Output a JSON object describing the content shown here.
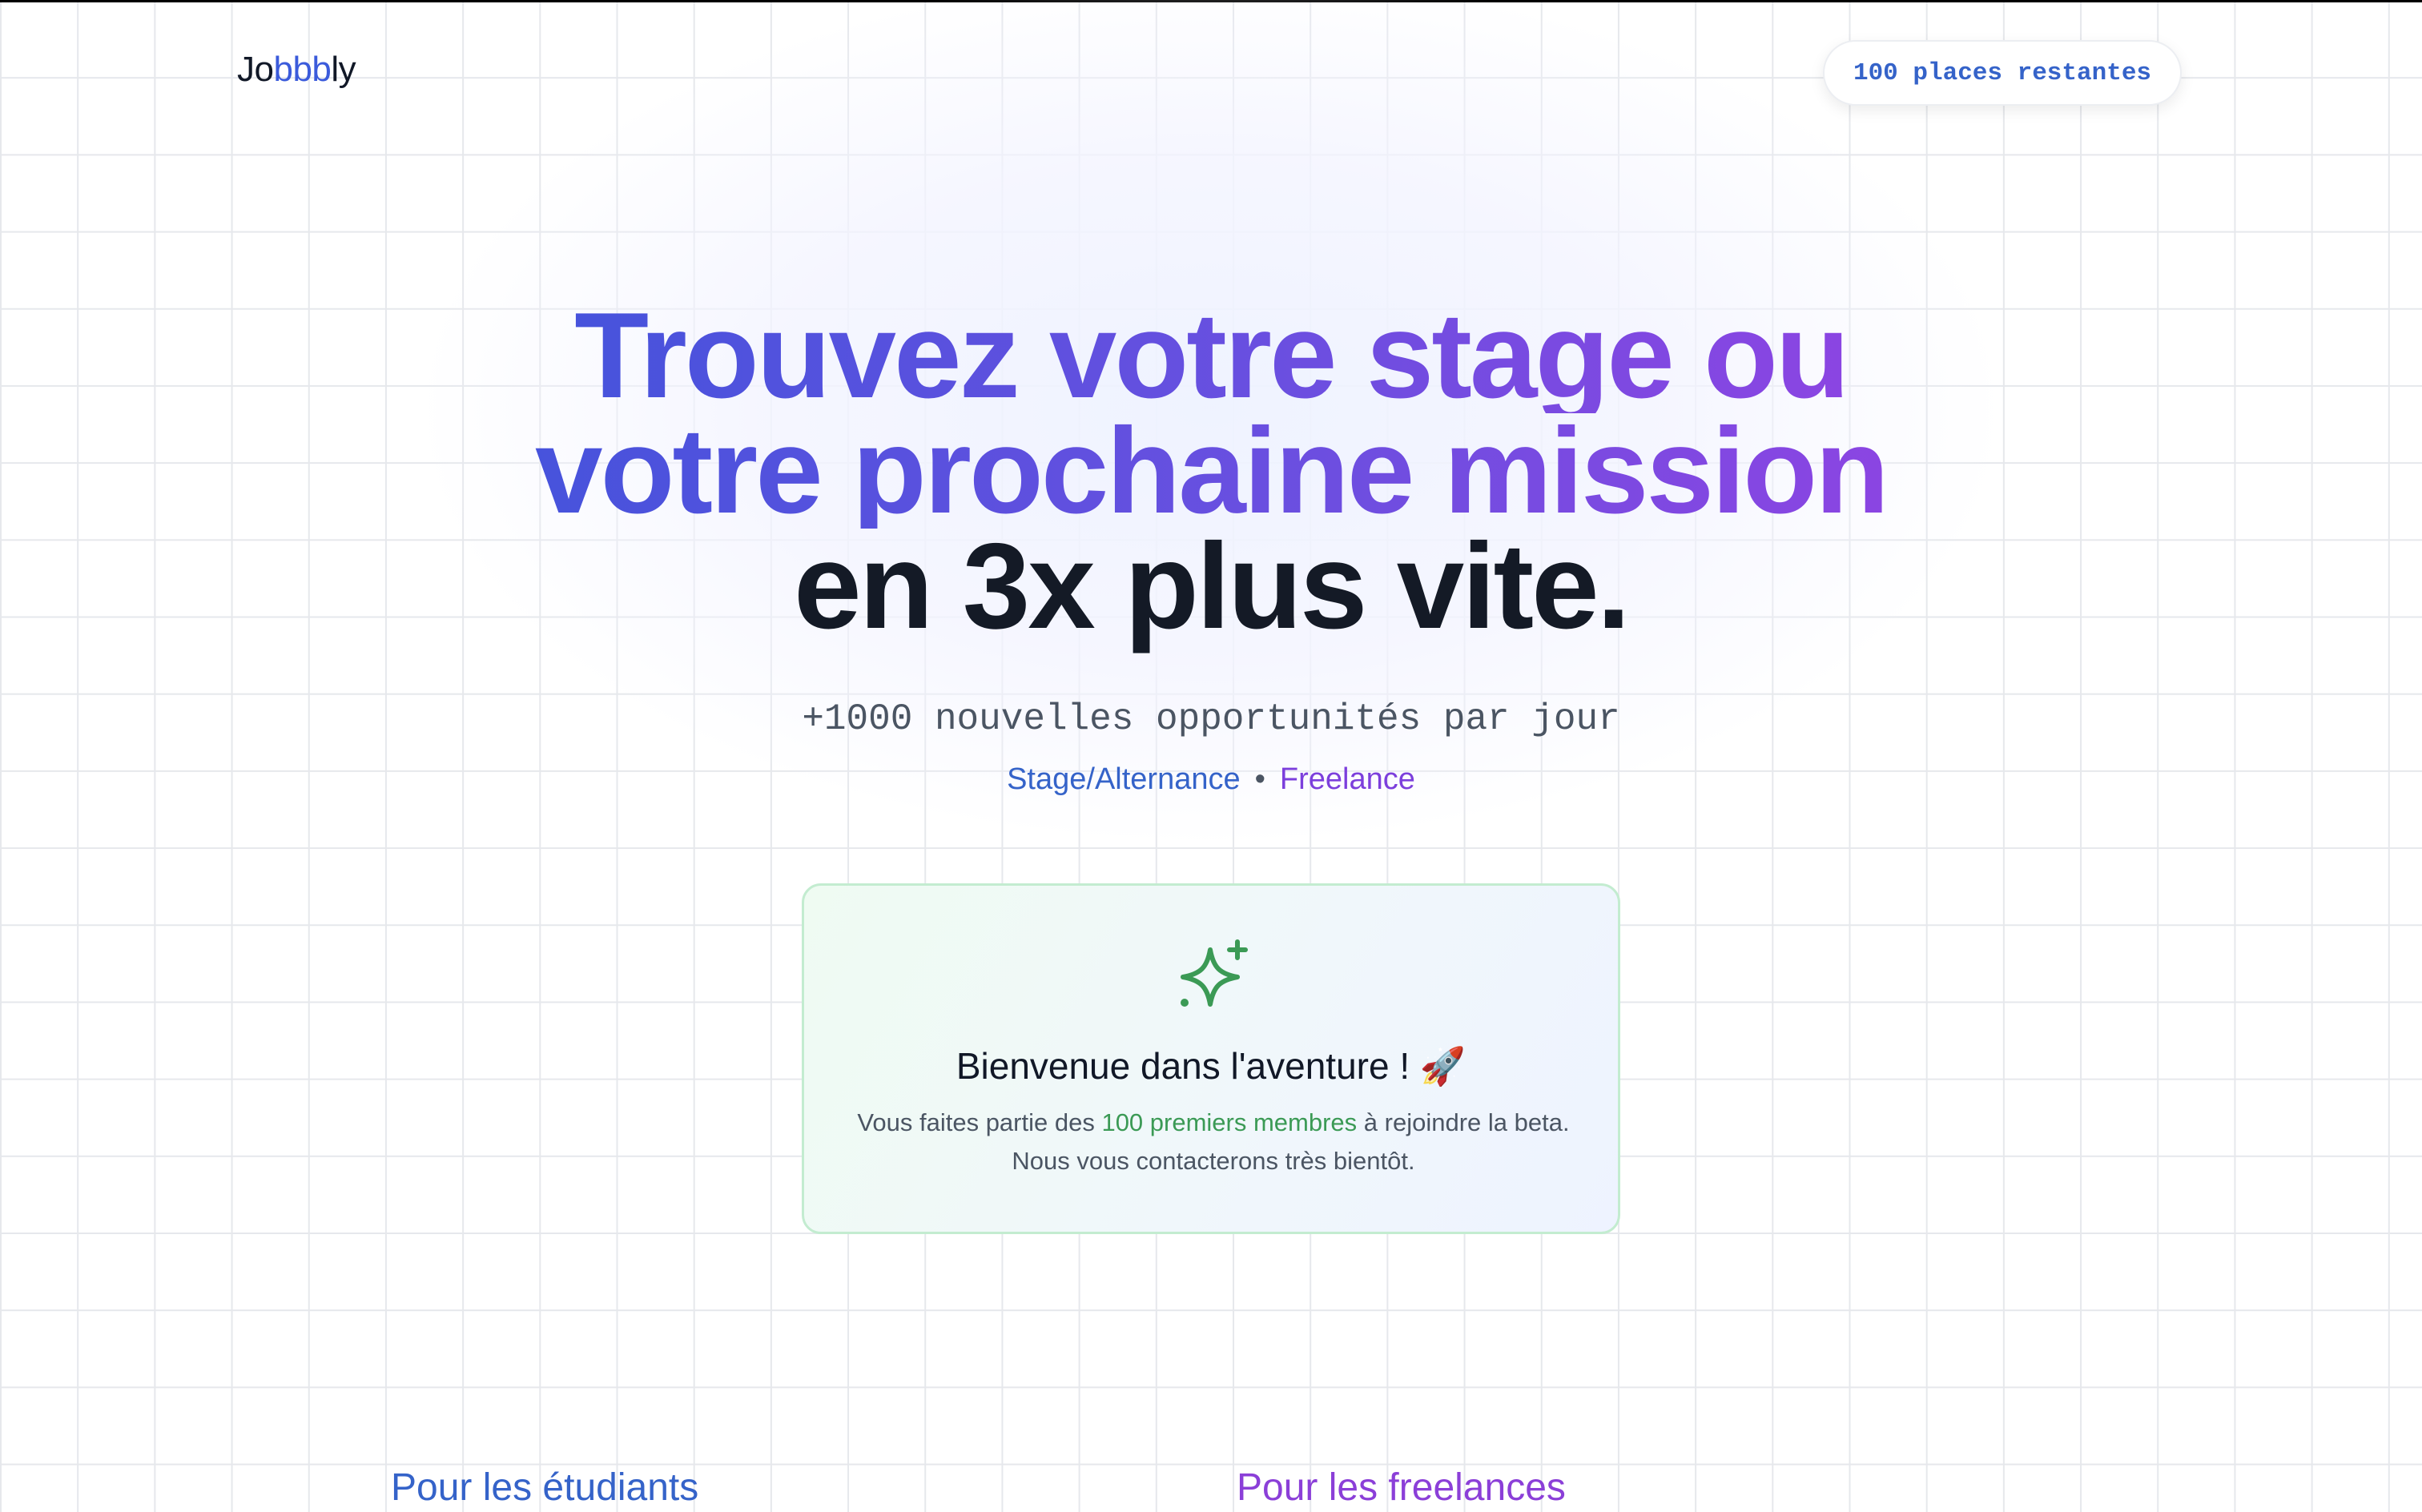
{
  "header": {
    "logo": {
      "part1": "Jo",
      "part2": "bbb",
      "part3": "ly"
    },
    "badge_label": "100 places restantes"
  },
  "hero": {
    "line1": "Trouvez votre stage ou",
    "line2": "votre prochaine mission",
    "line3": "en 3x plus vite."
  },
  "subtitle": "+1000 nouvelles opportunités par jour",
  "tags": {
    "first": "Stage/Alternance",
    "separator": "•",
    "second": "Freelance"
  },
  "welcome_card": {
    "icon": "sparkle-icon",
    "title": "Bienvenue dans l'aventure ! 🚀",
    "body_before": "Vous faites partie des ",
    "body_highlight": "100 premiers membres",
    "body_after": " à rejoindre la beta. Nous vous contacterons très bientôt."
  },
  "sections": {
    "students_title": "Pour les étudiants",
    "freelances_title": "Pour les freelances"
  },
  "colors": {
    "accent_blue": "#3563c9",
    "accent_purple": "#8b3fd8",
    "success_green": "#3b9a55"
  }
}
